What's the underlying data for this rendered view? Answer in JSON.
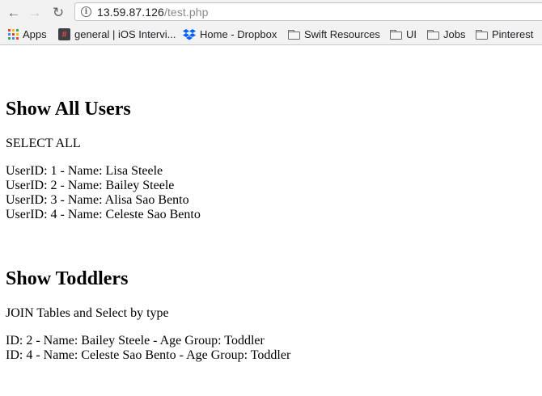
{
  "browser": {
    "url_host": "13.59.87.126",
    "url_path": "/test.php",
    "nav": {
      "back_icon": "arrow-left-icon",
      "forward_icon": "arrow-right-icon",
      "reload_icon": "reload-icon"
    }
  },
  "bookmarks": [
    {
      "label": "Apps",
      "icon": "apps-grid-icon"
    },
    {
      "label": "general | iOS Intervi...",
      "icon": "site-favicon"
    },
    {
      "label": "Home - Dropbox",
      "icon": "dropbox-icon"
    },
    {
      "label": "Swift Resources",
      "icon": "folder-icon"
    },
    {
      "label": "UI",
      "icon": "folder-icon"
    },
    {
      "label": "Jobs",
      "icon": "folder-icon"
    },
    {
      "label": "Pinterest",
      "icon": "folder-icon"
    }
  ],
  "page": {
    "section1": {
      "heading": "Show All Users",
      "subtitle": "SELECT ALL",
      "rows": [
        "UserID: 1 - Name: Lisa Steele",
        "UserID: 2 - Name: Bailey Steele",
        "UserID: 3 - Name: Alisa Sao Bento",
        "UserID: 4 - Name: Celeste Sao Bento"
      ]
    },
    "section2": {
      "heading": "Show Toddlers",
      "subtitle": "JOIN Tables and Select by type",
      "rows": [
        "ID: 2 - Name: Bailey Steele - Age Group: Toddler",
        "ID: 4 - Name: Celeste Sao Bento - Age Group: Toddler"
      ]
    }
  },
  "colors": {
    "dropbox": "#0061fe",
    "chrome_bg": "#f2f2f2"
  }
}
